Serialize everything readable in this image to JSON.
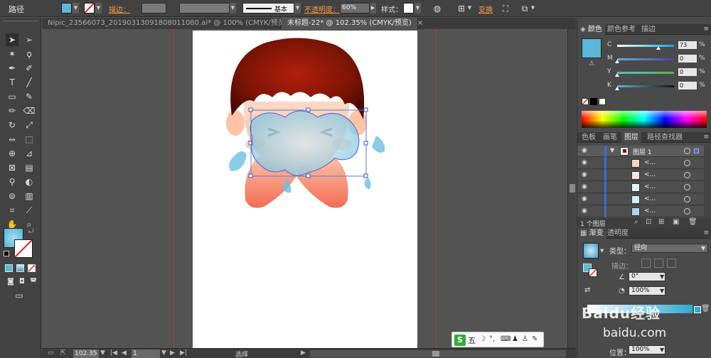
{
  "control_bar": {
    "object_type": "路径",
    "stroke_label": "描边：",
    "stroke_style": "基本",
    "opacity_label": "不透明度：",
    "opacity_value": "60%",
    "style_label": "样式：",
    "transform_label": "变换",
    "fill_color": "#5bb8d8"
  },
  "tabs": [
    {
      "label": "Nipic_23566073_20190313091808011080.ai* @ 100% (CMYK/预览)",
      "close": "×"
    },
    {
      "label": "未标题-22* @ 102.35% (CMYK/预览)",
      "close": "×"
    }
  ],
  "status_bar": {
    "zoom": "102.35",
    "page": "1",
    "status": "选择"
  },
  "color_panel": {
    "tabs": [
      "颜色",
      "颜色参考",
      "描边"
    ],
    "swatch_color": "#5bb8d8",
    "channels": [
      {
        "label": "C",
        "value": "73",
        "unit": "%",
        "fraction": 0.73
      },
      {
        "label": "M",
        "value": "0",
        "unit": "%",
        "fraction": 0
      },
      {
        "label": "Y",
        "value": "0",
        "unit": "%",
        "fraction": 0
      },
      {
        "label": "K",
        "value": "0",
        "unit": "%",
        "fraction": 0
      }
    ]
  },
  "layers_panel": {
    "tabs": [
      "色板",
      "画笔",
      "图层",
      "路径查找器"
    ],
    "layer_name": "图层 1",
    "sublayer_label": "<...",
    "footer": "1 个图层"
  },
  "gradient_panel": {
    "tabs": [
      "渐变",
      "透明度"
    ],
    "type_label": "类型：",
    "type_value": "径向",
    "stroke_label": "描边：",
    "angle_value": "0°",
    "aspect_value": "100%",
    "position_label": "位置：",
    "position_value": "100%"
  },
  "ime": {
    "logo": "S",
    "mode": "五"
  },
  "watermark": {
    "brand": "Baidu经验",
    "url": "baidu.com"
  }
}
